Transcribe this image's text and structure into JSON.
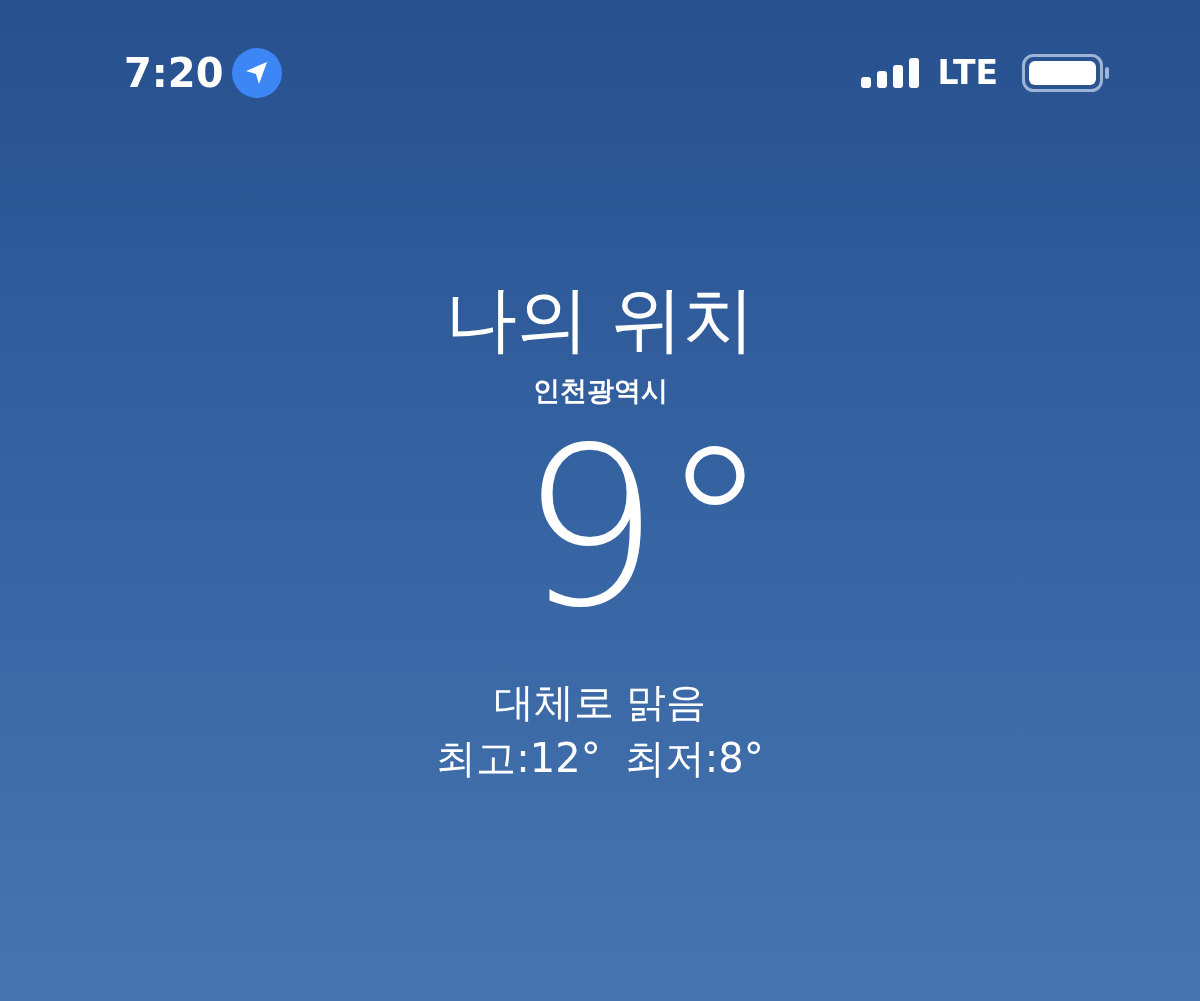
{
  "status_bar": {
    "time": "7:20",
    "network": "LTE"
  },
  "location": {
    "title": "나의 위치",
    "city": "인천광역시"
  },
  "current": {
    "temperature": "9°",
    "condition": "대체로 맑음",
    "high": "최고:12°",
    "low": "최저:8°"
  }
}
